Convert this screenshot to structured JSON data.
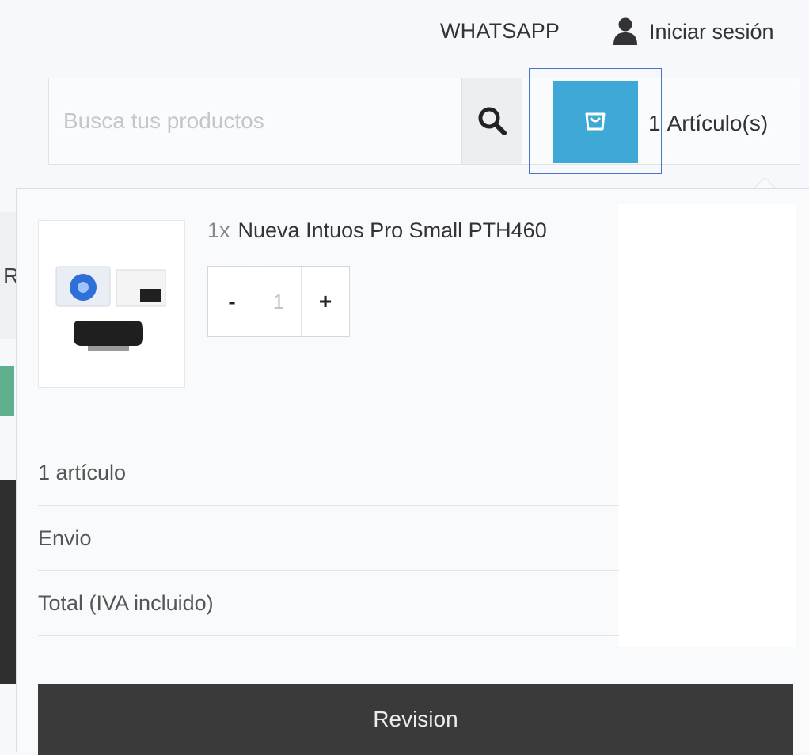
{
  "header": {
    "whatsapp_label": "WHATSAPP",
    "login_label": "Iniciar sesión",
    "login_icon": "user-icon"
  },
  "search": {
    "placeholder": "Busca tus productos",
    "value": "",
    "button_icon": "search-icon"
  },
  "cart": {
    "icon": "shopping-bag-icon",
    "count": "1",
    "count_label": "Artículo(s)",
    "accent_color": "#3ea8d6"
  },
  "background": {
    "edge_letter": "R"
  },
  "dropdown": {
    "item": {
      "quantity_prefix": "1x",
      "name": "Nueva Intuos Pro Small PTH460",
      "quantity": "1",
      "decrement_label": "-",
      "increment_label": "+"
    },
    "summary": {
      "items_label": "1 artículo",
      "shipping_label": "Envio",
      "total_label": "Total (IVA incluido)"
    },
    "checkout_label": "Revision"
  }
}
